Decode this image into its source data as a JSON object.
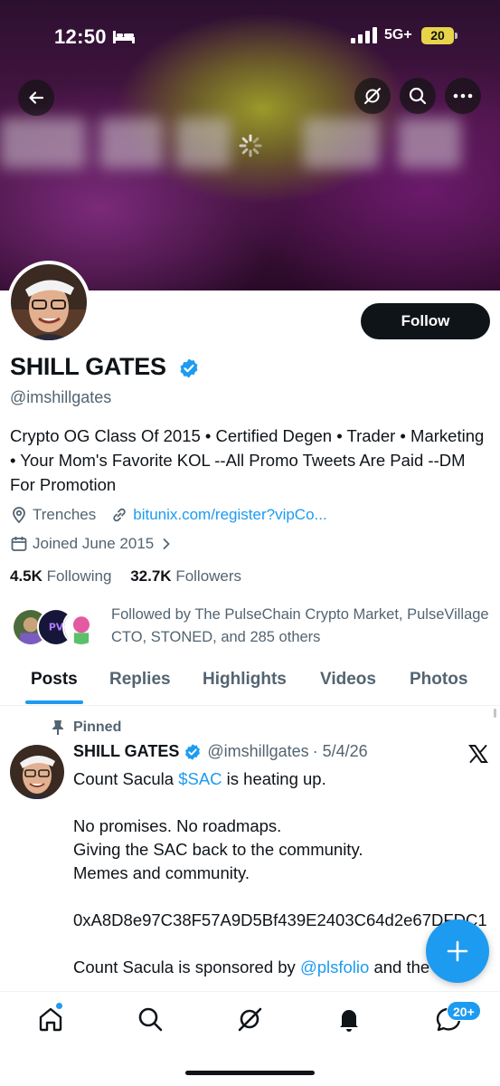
{
  "status_bar": {
    "time": "12:50",
    "network": "5G+",
    "battery": "20"
  },
  "profile": {
    "name": "SHILL GATES",
    "handle": "@imshillgates",
    "bio": "Crypto OG Class Of 2015 • Certified Degen • Trader • Marketing • Your Mom's Favorite KOL --All Promo Tweets Are Paid --DM For Promotion",
    "location": "Trenches",
    "website": "bitunix.com/register?vipCo...",
    "joined": "Joined June 2015",
    "following_count": "4.5K",
    "following_label": "Following",
    "followers_count": "32.7K",
    "followers_label": "Followers",
    "followed_by": "Followed by The PulseChain Crypto Market, PulseVillage CTO, STONED, and 285 others",
    "follow_button": "Follow"
  },
  "tabs": [
    {
      "label": "Posts"
    },
    {
      "label": "Replies"
    },
    {
      "label": "Highlights"
    },
    {
      "label": "Videos"
    },
    {
      "label": "Photos"
    }
  ],
  "pinned_tweet": {
    "pinned_label": "Pinned",
    "author_name": "SHILL GATES",
    "author_handle": "@imshillgates",
    "date": "· 5/4/26",
    "line1_prefix": "Count Sacula ",
    "cashtag": "$SAC",
    "line1_suffix": " is heating up.",
    "paragraph2": "No promises. No roadmaps.\nGiving the SAC back to the community.\nMemes and community.",
    "address": "0xA8D8e97C38F57A9D5Bf439E2403C64d2e67DFDC1",
    "line_last_prefix": "Count Sacula is sponsored by ",
    "mention": "@plsfolio",
    "line_last_suffix": " and the"
  },
  "bottom_nav": {
    "messages_badge": "20+"
  },
  "colors": {
    "accent": "#1d9bf0",
    "text": "#0f1419",
    "secondary": "#536471"
  }
}
